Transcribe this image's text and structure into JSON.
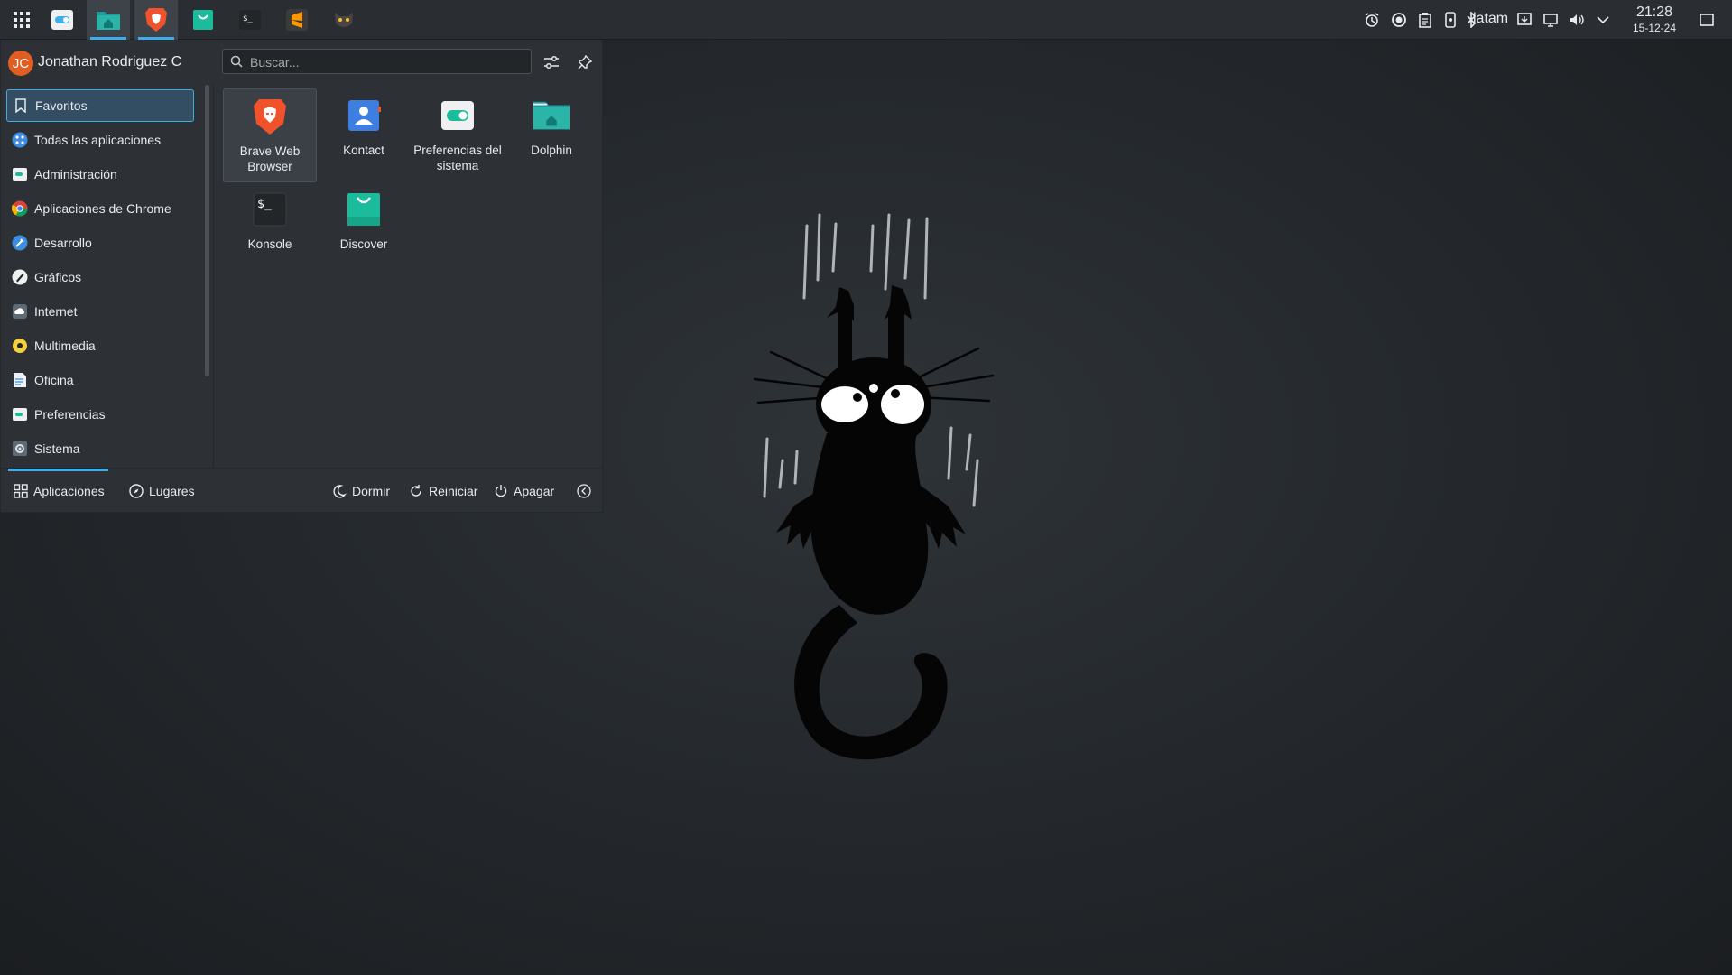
{
  "panel": {
    "launcher_icon": "app-grid-icon",
    "tasks": [
      {
        "name": "system-settings",
        "icon": "toggle-icon"
      },
      {
        "name": "dolphin",
        "icon": "folder-home-icon",
        "active": true
      },
      {
        "name": "brave",
        "icon": "brave-lion-icon",
        "active": true
      },
      {
        "name": "discover",
        "icon": "shopping-bag-icon"
      },
      {
        "name": "konsole",
        "icon": "terminal-icon"
      },
      {
        "name": "sublime-text",
        "icon": "sublime-icon"
      },
      {
        "name": "cat-app",
        "icon": "cat-face-icon"
      }
    ],
    "tray": {
      "keyboard_layout": "latam",
      "time": "21:28",
      "date": "15-12-24"
    }
  },
  "menu": {
    "user": {
      "initials": "JC",
      "name": "Jonathan Rodriguez C"
    },
    "search": {
      "placeholder": "Buscar..."
    },
    "categories": [
      {
        "label": "Favoritos",
        "icon": "bookmark-icon"
      },
      {
        "label": "Todas las aplicaciones",
        "icon": "all-apps-icon"
      },
      {
        "label": "Administración",
        "icon": "admin-icon"
      },
      {
        "label": "Aplicaciones de Chrome",
        "icon": "chrome-icon"
      },
      {
        "label": "Desarrollo",
        "icon": "development-icon"
      },
      {
        "label": "Gráficos",
        "icon": "graphics-icon"
      },
      {
        "label": "Internet",
        "icon": "cloud-icon"
      },
      {
        "label": "Multimedia",
        "icon": "multimedia-icon"
      },
      {
        "label": "Oficina",
        "icon": "office-icon"
      },
      {
        "label": "Preferencias",
        "icon": "preferences-icon"
      },
      {
        "label": "Sistema",
        "icon": "system-icon"
      }
    ],
    "apps": [
      {
        "label": "Brave Web Browser",
        "icon": "brave-lion-icon"
      },
      {
        "label": "Kontact",
        "icon": "contact-icon"
      },
      {
        "label": "Preferencias del sistema",
        "icon": "toggle-icon"
      },
      {
        "label": "Dolphin",
        "icon": "folder-home-icon"
      },
      {
        "label": "Konsole",
        "icon": "terminal-icon"
      },
      {
        "label": "Discover",
        "icon": "shopping-bag-icon"
      }
    ],
    "footer": {
      "tab_apps": "Aplicaciones",
      "tab_places": "Lugares",
      "sleep": "Dormir",
      "restart": "Reiniciar",
      "shutdown": "Apagar"
    }
  },
  "colors": {
    "accent": "#3daee9",
    "panel_bg": "#2a2e32",
    "menu_bg": "#2d3136",
    "avatar": "#e25d22"
  }
}
